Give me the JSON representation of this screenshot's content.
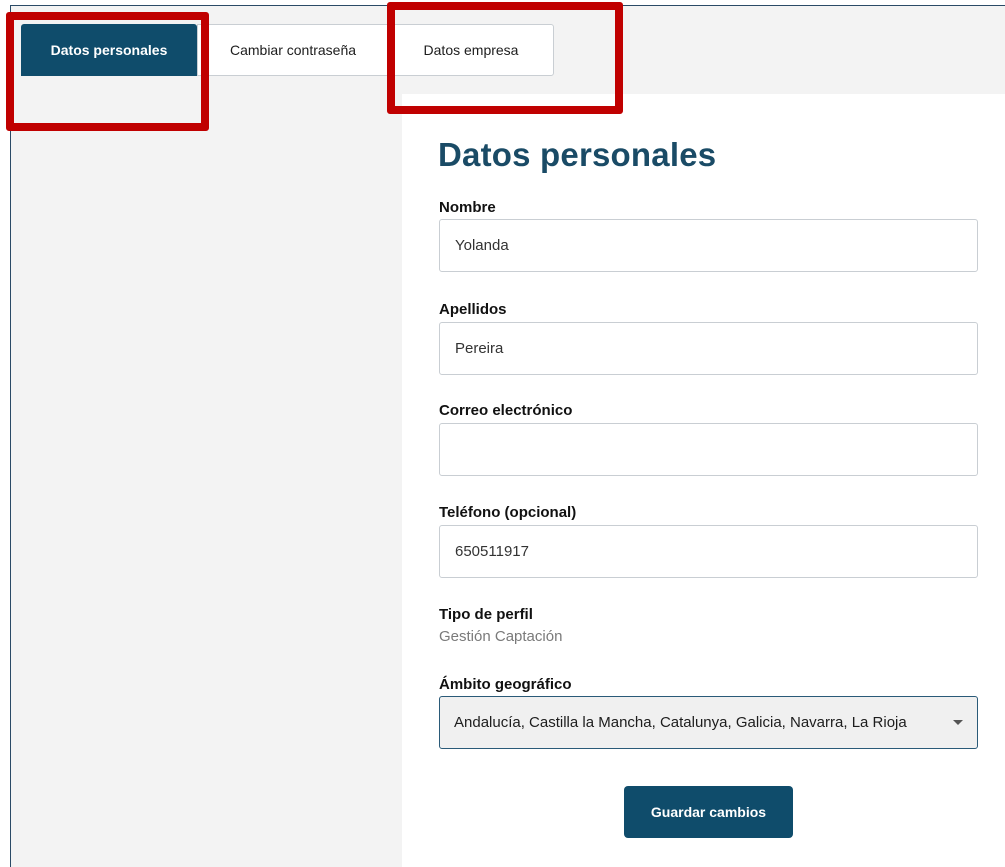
{
  "tabs": [
    {
      "label": "Datos personales",
      "active": true
    },
    {
      "label": "Cambiar contraseña",
      "active": false
    },
    {
      "label": "Datos empresa",
      "active": false
    }
  ],
  "form": {
    "title": "Datos personales",
    "nombre": {
      "label": "Nombre",
      "value": "Yolanda"
    },
    "apellidos": {
      "label": "Apellidos",
      "value": "Pereira"
    },
    "correo": {
      "label": "Correo electrónico",
      "value": ""
    },
    "telefono": {
      "label": "Teléfono (opcional)",
      "value": "650511917"
    },
    "perfil": {
      "label": "Tipo de perfil",
      "value": "Gestión Captación"
    },
    "ambito": {
      "label": "Ámbito geográfico",
      "value": "Andalucía, Castilla la Mancha, Catalunya, Galicia, Navarra, La Rioja"
    },
    "save_label": "Guardar cambios"
  },
  "colors": {
    "primary": "#0f4c6b",
    "title": "#1a4b66",
    "highlight": "#c00000"
  },
  "icons": {
    "dropdown": "chevron-down-icon"
  }
}
